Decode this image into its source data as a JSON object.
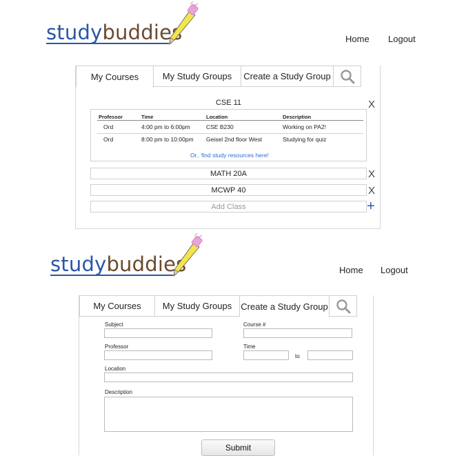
{
  "logo": {
    "part1": "study",
    "part2": "buddies"
  },
  "nav": {
    "home": "Home",
    "logout": "Logout"
  },
  "tabs": {
    "my_courses": "My Courses",
    "my_study_groups": "My Study Groups",
    "create_group": "Create a Study Group",
    "search_icon": "search-icon"
  },
  "courses": {
    "expanded": {
      "name": "CSE 11",
      "columns": [
        "Professor",
        "Time",
        "Location",
        "Description"
      ],
      "rows": [
        [
          "Ord",
          "4:00 pm to 6:00pm",
          "CSE B230",
          "Working on PA2!"
        ],
        [
          "Ord",
          "8:00 pm to 10:00pm",
          "Geisel 2nd floor West",
          "Studying for quiz"
        ]
      ],
      "resources_link": "Or.. find study resources here!"
    },
    "others": [
      "MATH 20A",
      "MCWP 40"
    ],
    "add_placeholder": "Add Class",
    "remove_glyph": "X",
    "add_glyph": "+"
  },
  "form": {
    "subject_label": "Subject",
    "course_label": "Course #",
    "professor_label": "Professor",
    "time_label": "Time",
    "time_to": "to",
    "location_label": "Location",
    "description_label": "Description",
    "submit": "Submit",
    "values": {
      "subject": "",
      "course": "",
      "professor": "",
      "time_from": "",
      "time_to": "",
      "location": "",
      "description": ""
    }
  },
  "colors": {
    "brand_blue": "#2a56a8",
    "brand_brown": "#6a4a2e",
    "link_blue": "#2a6cd0",
    "pencil_yellow": "#f2e64a",
    "eraser_pink": "#e8a4d4"
  }
}
